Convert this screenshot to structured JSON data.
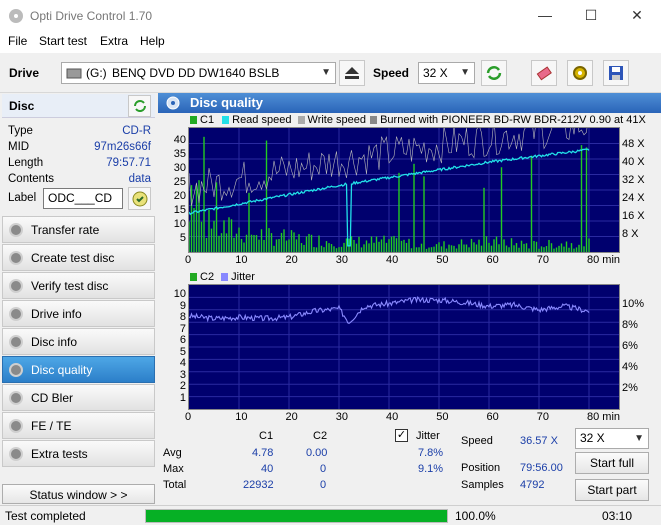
{
  "window": {
    "title": "Opti Drive Control 1.70",
    "min": "—",
    "max": "☐",
    "close": "✕"
  },
  "menu": [
    "File",
    "Start test",
    "Extra",
    "Help"
  ],
  "toolbar": {
    "drive_label": "Drive",
    "drive_letter": "(G:)",
    "drive_name": "BENQ DVD DD DW1640 BSLB",
    "speed_label": "Speed",
    "speed_value": "32 X"
  },
  "disc": {
    "header": "Disc",
    "type_label": "Type",
    "type": "CD-R",
    "mid_label": "MID",
    "mid": "97m26s66f",
    "length_label": "Length",
    "length": "79:57.71",
    "contents_label": "Contents",
    "contents": "data",
    "label_label": "Label",
    "label": "ODC___CD"
  },
  "nav": [
    {
      "label": "Transfer rate",
      "active": false
    },
    {
      "label": "Create test disc",
      "active": false
    },
    {
      "label": "Verify test disc",
      "active": false
    },
    {
      "label": "Drive info",
      "active": false
    },
    {
      "label": "Disc info",
      "active": false
    },
    {
      "label": "Disc quality",
      "active": true
    },
    {
      "label": "CD Bler",
      "active": false
    },
    {
      "label": "FE / TE",
      "active": false
    },
    {
      "label": "Extra tests",
      "active": false
    }
  ],
  "status_window_btn": "Status window > >",
  "main_title": "Disc quality",
  "chart_data": [
    {
      "type": "line",
      "legend": [
        "C1",
        "Read speed",
        "Write speed",
        "Burned with PIONEER BD-RW   BDR-212V 0.90 at 41X"
      ],
      "x_ticks": [
        "0",
        "10",
        "20",
        "30",
        "40",
        "50",
        "60",
        "70",
        "80 min"
      ],
      "y_left_ticks": [
        "40",
        "35",
        "30",
        "25",
        "20",
        "15",
        "10",
        "5"
      ],
      "y_right_ticks": [
        "48 X",
        "40 X",
        "32 X",
        "24 X",
        "16 X",
        "8 X"
      ],
      "xlim": [
        0,
        80
      ],
      "ylim": [
        0,
        40
      ],
      "series": [
        {
          "name": "Read speed",
          "unit": "X",
          "x": [
            0,
            10,
            20,
            30,
            40,
            50,
            60,
            70,
            80
          ],
          "values": [
            12.5,
            15.5,
            18.5,
            21.5,
            24.0,
            26.5,
            29.0,
            31.0,
            33.0
          ]
        },
        {
          "name": "C1",
          "x": [
            0,
            10,
            20,
            30,
            40,
            50,
            60,
            70,
            80
          ],
          "values": [
            9,
            6,
            4,
            3,
            3,
            2,
            3,
            2,
            3
          ]
        }
      ],
      "colors": {
        "c1": "#22cc22",
        "read": "#22e0e8",
        "write": "#bbbbbb",
        "bg": "#00006e"
      }
    },
    {
      "type": "line",
      "legend": [
        "C2",
        "Jitter"
      ],
      "x_ticks": [
        "0",
        "10",
        "20",
        "30",
        "40",
        "50",
        "60",
        "70",
        "80 min"
      ],
      "y_left_ticks": [
        "10",
        "9",
        "8",
        "7",
        "6",
        "5",
        "4",
        "3",
        "2",
        "1"
      ],
      "y_right_ticks": [
        "10%",
        "8%",
        "6%",
        "4%",
        "2%"
      ],
      "xlim": [
        0,
        80
      ],
      "ylim": [
        0,
        10
      ],
      "series": [
        {
          "name": "Jitter",
          "unit": "%",
          "x": [
            0,
            5,
            10,
            15,
            20,
            25,
            30,
            32,
            35,
            40,
            45,
            50,
            55,
            60,
            65,
            70,
            75,
            80
          ],
          "values": [
            7.5,
            7.3,
            7.4,
            7.3,
            7.4,
            7.9,
            8.1,
            7.0,
            8.3,
            8.5,
            8.8,
            8.8,
            8.6,
            8.3,
            8.4,
            8.0,
            8.3,
            7.9
          ]
        }
      ]
    }
  ],
  "stats": {
    "h_c1": "C1",
    "h_c2": "C2",
    "avg_label": "Avg",
    "avg_c1": "4.78",
    "avg_c2": "0.00",
    "max_label": "Max",
    "max_c1": "40",
    "max_c2": "0",
    "total_label": "Total",
    "total_c1": "22932",
    "total_c2": "0",
    "jitter_label": "Jitter",
    "jitter_avg": "7.8%",
    "jitter_max": "9.1%",
    "speed_label": "Speed",
    "speed": "36.57 X",
    "position_label": "Position",
    "position": "79:56.00",
    "samples_label": "Samples",
    "samples": "4792",
    "speed_select": "32 X",
    "start_full": "Start full",
    "start_part": "Start part"
  },
  "status": {
    "text": "Test completed",
    "progress": 100,
    "progress_text": "100.0%",
    "time": "03:10"
  }
}
